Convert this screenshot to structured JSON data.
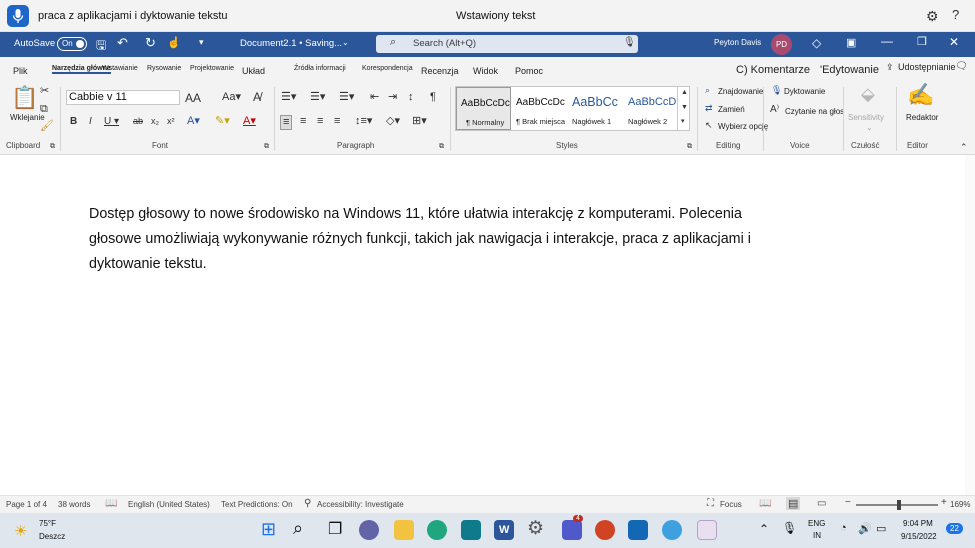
{
  "voice": {
    "command_text": "praca z aplikacjami i dyktowanie tekstu",
    "status": "Wstawiony tekst"
  },
  "titlebar": {
    "autosave_label": "AutoSave",
    "autosave_state": "On",
    "doc_title": "Document2.1 • Saving...",
    "search_placeholder": "Search (Alt+Q)",
    "user_name": "Peyton Davis",
    "user_initials": "PD"
  },
  "tabs": [
    {
      "label": "Plik"
    },
    {
      "label": "Narzędzia główne"
    },
    {
      "label": "Wstawianie"
    },
    {
      "label": "Rysowanie"
    },
    {
      "label": "Projektowanie"
    },
    {
      "label": "Układ"
    },
    {
      "label": "Źródła informacji"
    },
    {
      "label": "Korespondencja"
    },
    {
      "label": "Recenzja"
    },
    {
      "label": "Widok"
    },
    {
      "label": "Pomoc"
    }
  ],
  "tab_actions": {
    "comments": "C) Komentarze",
    "editing": "'Edytowanie",
    "share": "Udostępnianie"
  },
  "ribbon": {
    "paste_label": "Wklejanie",
    "font_name": "Cabbie v 11",
    "styles": [
      {
        "preview": "AaBbCcDc",
        "name": "¶ Normalny"
      },
      {
        "preview": "AaBbCcDc",
        "name": "¶ Brak miejsca"
      },
      {
        "preview": "AaBbCc",
        "name": "Nagłówek 1"
      },
      {
        "preview": "AaBbCcD",
        "name": "Nagłówek 2"
      }
    ],
    "find_label": "Znajdowanie",
    "replace_label": "Zamień",
    "select_label": "Wybierz opcję",
    "dictate_label": "Dyktowanie",
    "read_aloud_label": "Czytanie na głos",
    "sensitivity_label": "Sensitivity",
    "editor_label": "Redaktor",
    "groups": {
      "clipboard": "Clipboard",
      "font": "Font",
      "paragraph": "Paragraph",
      "styles": "Styles",
      "editing": "Editing",
      "voice": "Voice",
      "sensitivity": "Czułość",
      "editor": "Editor"
    }
  },
  "document": {
    "paragraph": "Dostęp głosowy to nowe środowisko na Windows 11, które ułatwia interakcję z komputerami. Polecenia głosowe umożliwiają wykonywanie różnych funkcji, takich jak nawigacja i interakcje, praca z aplikacjami i dyktowanie tekstu."
  },
  "statusbar": {
    "page": "Page 1 of 4",
    "words": "38 words",
    "language": "English (United States)",
    "predictions": "Text Predictions: On",
    "accessibility": "Accessibility: Investigate",
    "focus": "Focus",
    "zoom": "169%"
  },
  "taskbar": {
    "weather_temp": "75°F",
    "weather_desc": "Deszcz",
    "lang_top": "ENG",
    "lang_bottom": "IN",
    "time": "9:04 PM",
    "date": "9/15/2022",
    "notifications": "22",
    "teams_badge": "4"
  }
}
